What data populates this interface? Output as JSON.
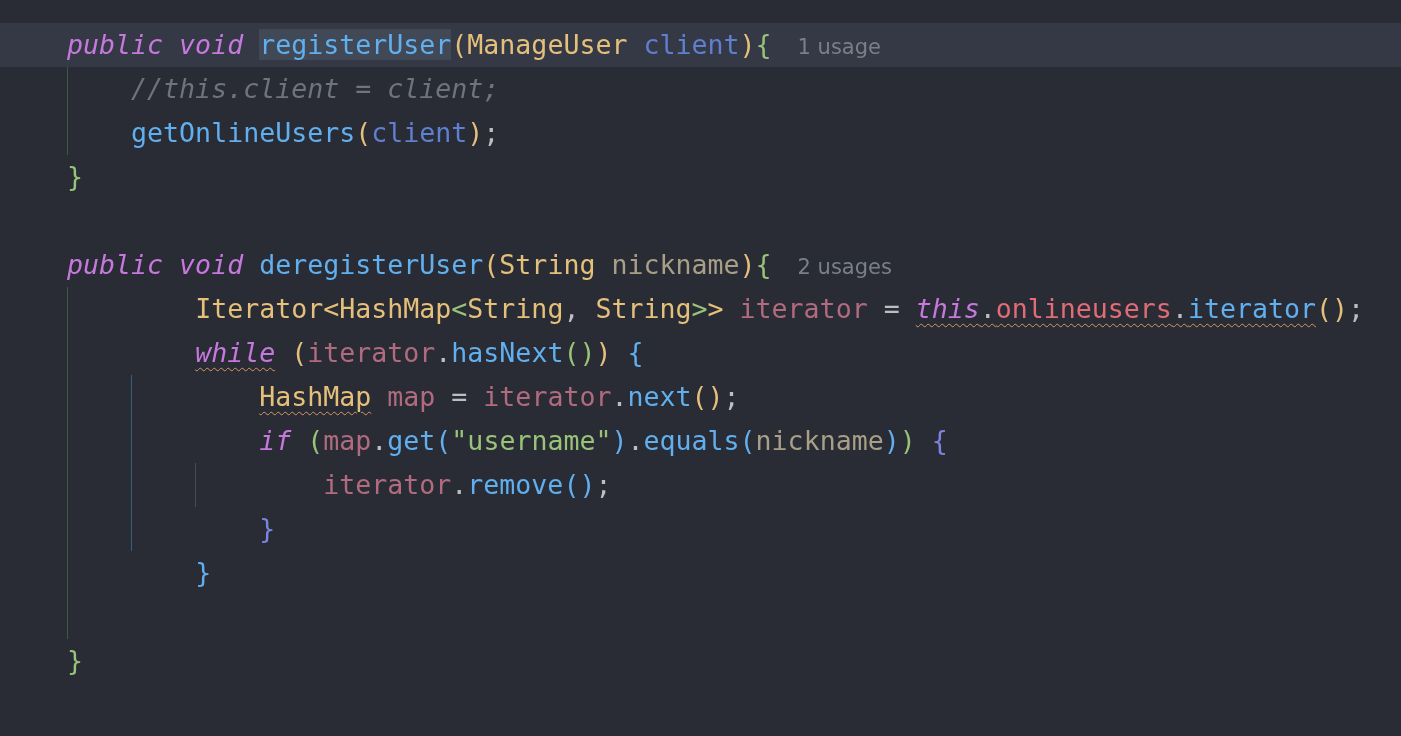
{
  "editor": {
    "lines": [
      {
        "kind": "code",
        "current": true,
        "hint": "1 usage",
        "tokens": [
          {
            "text": "public void ",
            "kind": "keyword",
            "warning": false,
            "highlighted": false
          },
          {
            "text": "registerUser",
            "kind": "function",
            "warning": false,
            "highlighted": true
          },
          {
            "text": "(",
            "kind": "bracket1",
            "warning": false,
            "highlighted": false
          },
          {
            "text": "ManageUser ",
            "kind": "type",
            "warning": false,
            "highlighted": false
          },
          {
            "text": "client",
            "kind": "parameter",
            "warning": false,
            "highlighted": false
          },
          {
            "text": ")",
            "kind": "bracket1",
            "warning": false,
            "highlighted": false
          },
          {
            "text": "{",
            "kind": "bracket2",
            "warning": false,
            "highlighted": false
          }
        ]
      },
      {
        "kind": "code",
        "current": false,
        "tokens": [
          {
            "text": "//this.client = client;",
            "kind": "comment",
            "warning": false,
            "highlighted": false
          }
        ]
      },
      {
        "kind": "code",
        "current": false,
        "tokens": [
          {
            "text": "getOnlineUsers",
            "kind": "function",
            "warning": false,
            "highlighted": false
          },
          {
            "text": "(",
            "kind": "bracket1",
            "warning": false,
            "highlighted": false
          },
          {
            "text": "client",
            "kind": "parameter",
            "warning": false,
            "highlighted": false
          },
          {
            "text": ")",
            "kind": "bracket1",
            "warning": false,
            "highlighted": false
          },
          {
            "text": ";",
            "kind": "plain",
            "warning": false,
            "highlighted": false
          }
        ]
      },
      {
        "kind": "code",
        "current": false,
        "tokens": [
          {
            "text": "}",
            "kind": "bracket2",
            "warning": false,
            "highlighted": false
          }
        ]
      },
      {
        "kind": "blank"
      },
      {
        "kind": "code",
        "current": false,
        "hint": "2 usages",
        "tokens": [
          {
            "text": "public void ",
            "kind": "keyword",
            "warning": false,
            "highlighted": false
          },
          {
            "text": "deregisterUser",
            "kind": "function",
            "warning": false,
            "highlighted": false
          },
          {
            "text": "(",
            "kind": "bracket1",
            "warning": false,
            "highlighted": false
          },
          {
            "text": "String ",
            "kind": "type",
            "warning": false,
            "highlighted": false
          },
          {
            "text": "nickname",
            "kind": "parameter-alt",
            "warning": false,
            "highlighted": false
          },
          {
            "text": ")",
            "kind": "bracket1",
            "warning": false,
            "highlighted": false
          },
          {
            "text": "{",
            "kind": "bracket2",
            "warning": false,
            "highlighted": false
          }
        ]
      },
      {
        "kind": "code",
        "current": false,
        "tokens": [
          {
            "text": "Iterator",
            "kind": "type",
            "warning": false,
            "highlighted": false
          },
          {
            "text": "<",
            "kind": "bracket1",
            "warning": false,
            "highlighted": false
          },
          {
            "text": "HashMap",
            "kind": "type",
            "warning": false,
            "highlighted": false
          },
          {
            "text": "<",
            "kind": "bracket2",
            "warning": false,
            "highlighted": false
          },
          {
            "text": "String",
            "kind": "type",
            "warning": false,
            "highlighted": false
          },
          {
            "text": ", ",
            "kind": "plain",
            "warning": false,
            "highlighted": false
          },
          {
            "text": "String",
            "kind": "type",
            "warning": false,
            "highlighted": false
          },
          {
            "text": ">",
            "kind": "bracket2",
            "warning": false,
            "highlighted": false
          },
          {
            "text": "> ",
            "kind": "bracket1",
            "warning": false,
            "highlighted": false
          },
          {
            "text": "iterator",
            "kind": "local",
            "warning": false,
            "highlighted": false
          },
          {
            "text": " = ",
            "kind": "plain",
            "warning": false,
            "highlighted": false
          },
          {
            "text": "this",
            "kind": "keyword",
            "warning": true,
            "highlighted": false
          },
          {
            "text": ".",
            "kind": "plain",
            "warning": true,
            "highlighted": false
          },
          {
            "text": "onlineusers",
            "kind": "field",
            "warning": true,
            "highlighted": false
          },
          {
            "text": ".",
            "kind": "plain",
            "warning": true,
            "highlighted": false
          },
          {
            "text": "iterator",
            "kind": "function",
            "warning": true,
            "highlighted": false
          },
          {
            "text": "()",
            "kind": "bracket1",
            "warning": false,
            "highlighted": false
          },
          {
            "text": ";",
            "kind": "plain",
            "warning": false,
            "highlighted": false
          }
        ]
      },
      {
        "kind": "code",
        "current": false,
        "tokens": [
          {
            "text": "while",
            "kind": "keyword",
            "warning": true,
            "highlighted": false
          },
          {
            "text": " (",
            "kind": "bracket1",
            "warning": false,
            "highlighted": false
          },
          {
            "text": "iterator",
            "kind": "local",
            "warning": false,
            "highlighted": false
          },
          {
            "text": ".",
            "kind": "plain",
            "warning": false,
            "highlighted": false
          },
          {
            "text": "hasNext",
            "kind": "function",
            "warning": false,
            "highlighted": false
          },
          {
            "text": "()",
            "kind": "bracket2",
            "warning": false,
            "highlighted": false
          },
          {
            "text": ") ",
            "kind": "bracket1",
            "warning": false,
            "highlighted": false
          },
          {
            "text": "{",
            "kind": "bracket3",
            "warning": false,
            "highlighted": false
          }
        ]
      },
      {
        "kind": "code",
        "current": false,
        "tokens": [
          {
            "text": "HashMap",
            "kind": "type",
            "warning": true,
            "highlighted": false
          },
          {
            "text": " map",
            "kind": "local",
            "warning": false,
            "highlighted": false
          },
          {
            "text": " = ",
            "kind": "plain",
            "warning": false,
            "highlighted": false
          },
          {
            "text": "iterator",
            "kind": "local",
            "warning": false,
            "highlighted": false
          },
          {
            "text": ".",
            "kind": "plain",
            "warning": false,
            "highlighted": false
          },
          {
            "text": "next",
            "kind": "function",
            "warning": false,
            "highlighted": false
          },
          {
            "text": "()",
            "kind": "bracket1",
            "warning": false,
            "highlighted": false
          },
          {
            "text": ";",
            "kind": "plain",
            "warning": false,
            "highlighted": false
          }
        ]
      },
      {
        "kind": "code",
        "current": false,
        "tokens": [
          {
            "text": "if ",
            "kind": "keyword",
            "warning": false,
            "highlighted": false
          },
          {
            "text": "(",
            "kind": "bracket2",
            "warning": false,
            "highlighted": false
          },
          {
            "text": "map",
            "kind": "local",
            "warning": false,
            "highlighted": false
          },
          {
            "text": ".",
            "kind": "plain",
            "warning": false,
            "highlighted": false
          },
          {
            "text": "get",
            "kind": "function",
            "warning": false,
            "highlighted": false
          },
          {
            "text": "(",
            "kind": "bracket3",
            "warning": false,
            "highlighted": false
          },
          {
            "text": "\"username\"",
            "kind": "string",
            "warning": false,
            "highlighted": false
          },
          {
            "text": ")",
            "kind": "bracket3",
            "warning": false,
            "highlighted": false
          },
          {
            "text": ".",
            "kind": "plain",
            "warning": false,
            "highlighted": false
          },
          {
            "text": "equals",
            "kind": "function",
            "warning": false,
            "highlighted": false
          },
          {
            "text": "(",
            "kind": "bracket3",
            "warning": false,
            "highlighted": false
          },
          {
            "text": "nickname",
            "kind": "parameter-alt",
            "warning": false,
            "highlighted": false
          },
          {
            "text": ")",
            "kind": "bracket3",
            "warning": false,
            "highlighted": false
          },
          {
            "text": ") ",
            "kind": "bracket2",
            "warning": false,
            "highlighted": false
          },
          {
            "text": "{",
            "kind": "bracket4",
            "warning": false,
            "highlighted": false
          }
        ]
      },
      {
        "kind": "code",
        "current": false,
        "tokens": [
          {
            "text": "iterator",
            "kind": "local",
            "warning": false,
            "highlighted": false
          },
          {
            "text": ".",
            "kind": "plain",
            "warning": false,
            "highlighted": false
          },
          {
            "text": "remove",
            "kind": "function",
            "warning": false,
            "highlighted": false
          },
          {
            "text": "()",
            "kind": "bracket3",
            "warning": false,
            "highlighted": false
          },
          {
            "text": ";",
            "kind": "plain",
            "warning": false,
            "highlighted": false
          }
        ]
      },
      {
        "kind": "code",
        "current": false,
        "tokens": [
          {
            "text": "}",
            "kind": "bracket4",
            "warning": false,
            "highlighted": false
          }
        ]
      },
      {
        "kind": "code",
        "current": false,
        "tokens": [
          {
            "text": "}",
            "kind": "bracket3",
            "warning": false,
            "highlighted": false
          }
        ]
      },
      {
        "kind": "blank"
      },
      {
        "kind": "code",
        "current": false,
        "tokens": [
          {
            "text": "}",
            "kind": "bracket2",
            "warning": false,
            "highlighted": false
          }
        ]
      }
    ]
  }
}
